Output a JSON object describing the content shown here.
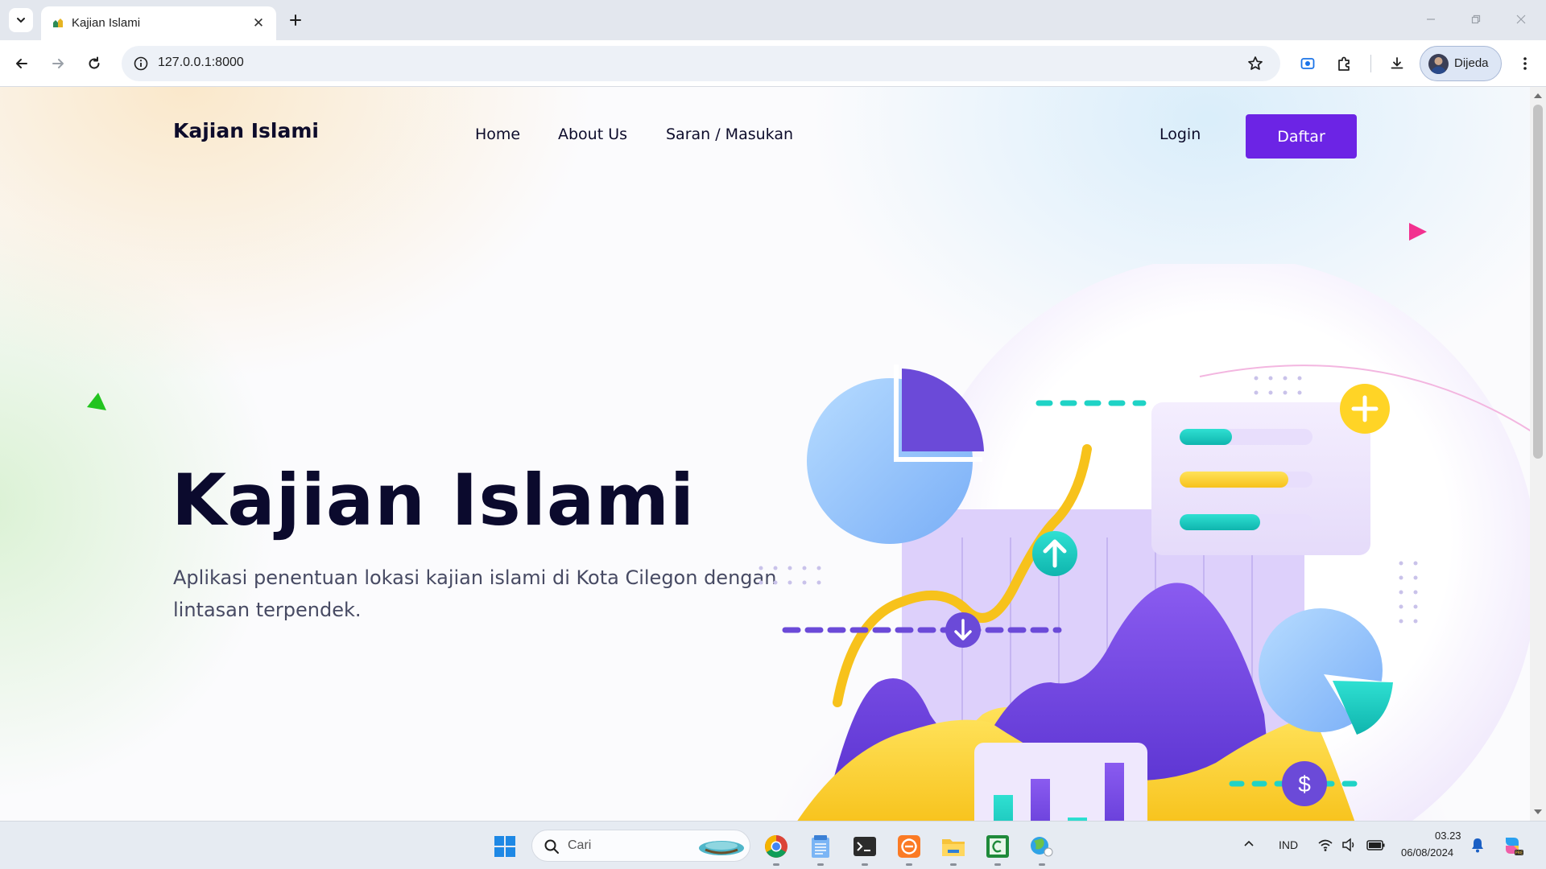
{
  "browser": {
    "tab_title": "Kajian Islami",
    "url": "127.0.0.1:8000",
    "profile_label": "Dijeda"
  },
  "site": {
    "brand": "Kajian Islami",
    "nav": [
      {
        "label": "Home"
      },
      {
        "label": "About Us"
      },
      {
        "label": "Saran / Masukan"
      }
    ],
    "login_label": "Login",
    "register_label": "Daftar",
    "accent_color": "#6c24e5"
  },
  "hero": {
    "title": "Kajian Islami",
    "subtitle": "Aplikasi penentuan lokasi kajian islami di Kota Cilegon dengan lintasan terpendek.",
    "illustration_icons": [
      "pie-chart-icon",
      "bar-chart-icon",
      "arrow-up-icon",
      "arrow-down-icon",
      "plus-icon",
      "dollar-icon"
    ]
  },
  "taskbar": {
    "search_placeholder": "Cari",
    "apps": [
      "windows-start-icon",
      "chrome-icon",
      "notepad-icon",
      "terminal-icon",
      "xampp-icon",
      "file-explorer-icon",
      "editor-icon",
      "weather-icon"
    ],
    "language": "IND",
    "time": "03.23",
    "date": "06/08/2024"
  }
}
